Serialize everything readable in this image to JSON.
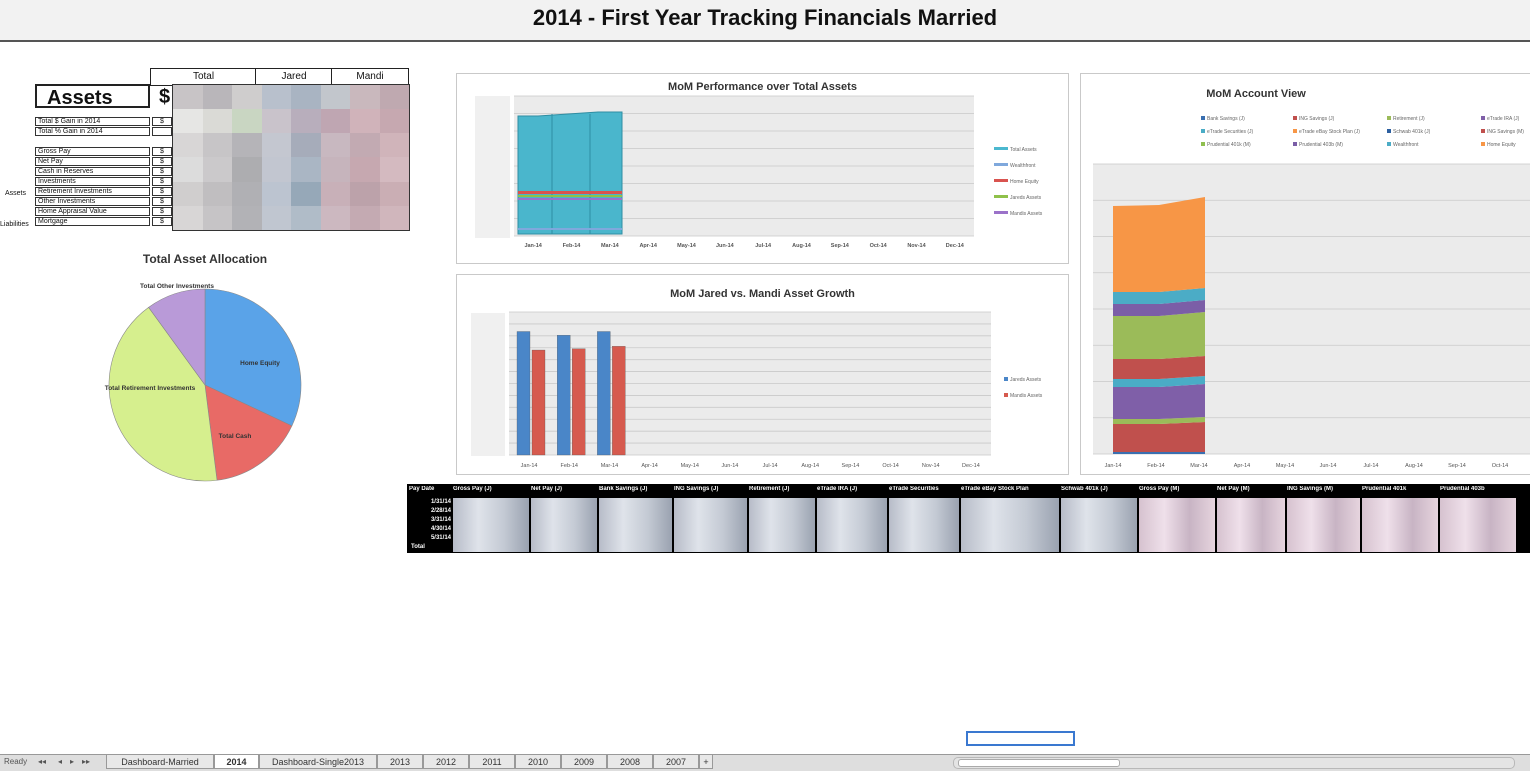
{
  "page_title": "2014 - First Year Tracking Financials Married",
  "assets_table": {
    "title": "Assets",
    "currency_symbol": "$",
    "col_headers": [
      "Total",
      "Jared",
      "Mandi"
    ],
    "rows": [
      {
        "label": "Total $ Gain in 2014",
        "cur": "$"
      },
      {
        "label": "Total % Gain in 2014",
        "cur": ""
      },
      {
        "label": "Gross Pay",
        "cur": "$"
      },
      {
        "label": "Net Pay",
        "cur": "$"
      },
      {
        "label": "Cash in Reserves",
        "cur": "$"
      },
      {
        "label": "Investments",
        "cur": "$"
      },
      {
        "label": "Retirement Investments",
        "cur": "$"
      },
      {
        "label": "Other Investments",
        "cur": "$"
      },
      {
        "label": "Home Appraisal Value",
        "cur": "$"
      },
      {
        "label": "Mortgage",
        "cur": "$"
      }
    ],
    "group_assets": "Assets",
    "group_liabilities": "Liabilities"
  },
  "pie": {
    "title": "Total Asset Allocation",
    "labels": [
      "Home Equity",
      "Total Cash",
      "Total Retirement Investments",
      "Total Other Investments"
    ],
    "colors": [
      "#5aa3e8",
      "#e86a66",
      "#d6ef8e",
      "#b99ad8"
    ],
    "values": [
      32,
      16,
      42,
      10
    ]
  },
  "chart1": {
    "title": "MoM Performance over Total Assets",
    "months": [
      "Jan-14",
      "Feb-14",
      "Mar-14",
      "Apr-14",
      "May-14",
      "Jun-14",
      "Jul-14",
      "Aug-14",
      "Sep-14",
      "Oct-14",
      "Nov-14",
      "Dec-14"
    ],
    "legend": [
      "Total Assets",
      "Wealthfront",
      "Home Equity",
      "Jareds Assets",
      "Mandis Assets"
    ],
    "legend_colors": [
      "#4bb8cf",
      "#7fa8dc",
      "#d9534f",
      "#8fc14a",
      "#9b72c9"
    ]
  },
  "chart2": {
    "title": "MoM Jared vs. Mandi Asset Growth",
    "months": [
      "Jan-14",
      "Feb-14",
      "Mar-14",
      "Apr-14",
      "May-14",
      "Jun-14",
      "Jul-14",
      "Aug-14",
      "Sep-14",
      "Oct-14",
      "Nov-14",
      "Dec-14"
    ],
    "legend": [
      "Jareds Assets",
      "Mandis Assets"
    ],
    "legend_colors": [
      "#4a86c8",
      "#d65a4e"
    ],
    "series": [
      {
        "name": "Jareds Assets",
        "values": [
          100,
          97,
          100
        ]
      },
      {
        "name": "Mandis Assets",
        "values": [
          85,
          86,
          88
        ]
      }
    ]
  },
  "chart3": {
    "title": "MoM Account View",
    "months": [
      "Jan-14",
      "Feb-14",
      "Mar-14",
      "Apr-14",
      "May-14",
      "Jun-14",
      "Jul-14",
      "Aug-14",
      "Sep-14",
      "Oct-14"
    ],
    "legend": [
      "Bank Savings (J)",
      "ING Savings (J)",
      "Retirement (J)",
      "eTrade IRA (J)",
      "eTrade Securities (J)",
      "eTrade eBay Stock Plan (J)",
      "Schwab 401k (J)",
      "ING Savings (M)",
      "Prudential 401k (M)",
      "Prudential 403b (M)",
      "Wealthfront",
      "Home Equity"
    ],
    "legend_colors": [
      "#3a6fb0",
      "#c0504d",
      "#9bbb59",
      "#7f5fa8",
      "#4aacc6",
      "#f79646",
      "#2c5fa0",
      "#c0504d",
      "#8fbf4f",
      "#7b5ea7",
      "#4bacc6",
      "#f79646"
    ]
  },
  "table_strip": {
    "headers": [
      "Pay Date",
      "Gross Pay (J)",
      "Net Pay (J)",
      "Bank Savings (J)",
      "ING Savings (J)",
      "Retirement (J)",
      "eTrade IRA (J)",
      "eTrade Securities",
      "eTrade eBay Stock Plan",
      "Schwab 401k (J)",
      "Gross Pay (M)",
      "Net Pay (M)",
      "ING Savings (M)",
      "Prudential 401k",
      "Prudential 403b"
    ],
    "rows": [
      "1/31/14",
      "2/28/14",
      "3/31/14",
      "4/30/14",
      "5/31/14",
      "Total"
    ]
  },
  "sheet_tabs": [
    "Dashboard-Married",
    "2014",
    "Dashboard-Single2013",
    "2013",
    "2012",
    "2011",
    "2010",
    "2009",
    "2008",
    "2007",
    "+"
  ],
  "active_tab": "2014",
  "left_label": "Ready"
}
